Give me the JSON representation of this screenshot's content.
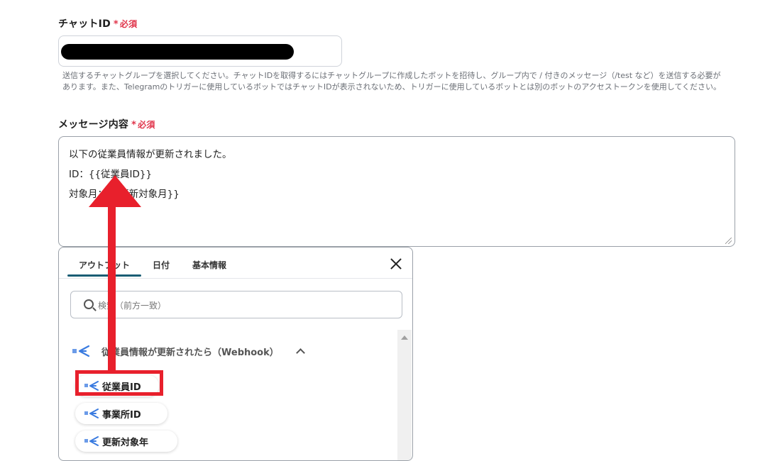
{
  "chat_id_field": {
    "label": "チャットID",
    "required_star": "*",
    "required_text": "必須",
    "value": "",
    "help_line1": "送信するチャットグループを選択してください。チャットIDを取得するにはチャットグループに作成したボットを招待し、グループ内で / 付きのメッセージ（/test など）を送信する必要が",
    "help_line2": "あります。また、Telegramのトリガーに使用しているボットではチャットIDが表示されないため、トリガーに使用しているボットとは別のボットのアクセストークンを使用してください。"
  },
  "message_field": {
    "label": "メッセージ内容",
    "required_star": "*",
    "required_text": "必須",
    "lines": [
      "以下の従業員情報が更新されました。",
      "ID：{{従業員ID}}",
      "対象月：{{更新対象月}}"
    ]
  },
  "popup": {
    "tabs": [
      "アウトプット",
      "日付",
      "基本情報"
    ],
    "active_tab": "アウトプット",
    "search_placeholder": "検索（前方一致）",
    "group_label": "従業員情報が更新されたら（Webhook）",
    "items": [
      "従業員ID",
      "事業所ID",
      "更新対象年"
    ]
  },
  "annotation": {
    "color": "#e8202c",
    "highlighted_item": "従業員ID"
  },
  "colors": {
    "required": "#e0344a",
    "tab_accent": "#1a5d74",
    "icon_blue": "#3a7be0"
  }
}
